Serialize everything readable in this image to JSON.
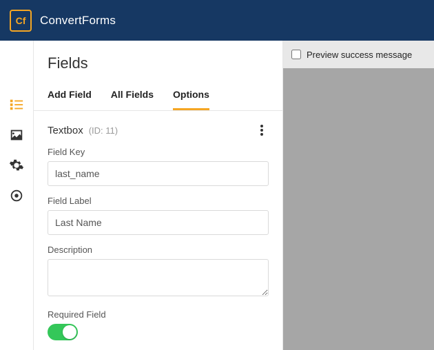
{
  "brand": {
    "initials": "Cf",
    "name": "ConvertForms"
  },
  "rails": {
    "items": [
      {
        "name": "fields-icon"
      },
      {
        "name": "image-icon"
      },
      {
        "name": "gear-icon"
      },
      {
        "name": "target-icon"
      }
    ]
  },
  "panel": {
    "title": "Fields",
    "tabs": {
      "add": "Add Field",
      "all": "All Fields",
      "options": "Options"
    },
    "section": {
      "type": "Textbox",
      "id_label": "(ID: 11)"
    },
    "labels": {
      "field_key": "Field Key",
      "field_label": "Field Label",
      "description": "Description",
      "required": "Required Field"
    },
    "values": {
      "field_key": "last_name",
      "field_label": "Last Name",
      "description": ""
    },
    "required_on": true
  },
  "preview": {
    "checkbox_label": "Preview success message"
  }
}
